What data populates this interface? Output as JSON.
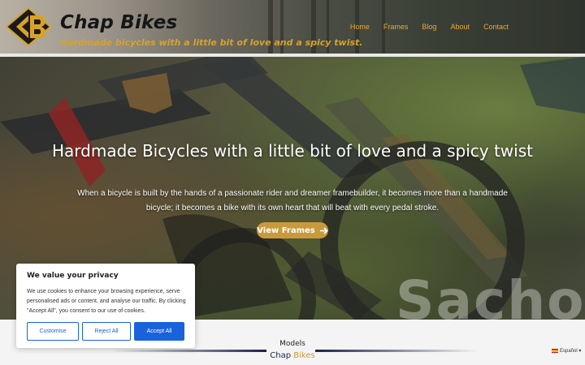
{
  "header": {
    "title": "Chap Bikes",
    "tagline": "Hardmade bicycles with a little bit of love and a spicy twist.",
    "nav": [
      "Home",
      "Frames",
      "Blog",
      "About",
      "Contact"
    ]
  },
  "hero": {
    "title": "Hardmade Bicycles with a little bit of love and a spicy twist",
    "text": "When a bicycle is built by the hands of a passionate rider and dreamer framebuilder, it becomes more than a handmade bicycle; it becomes a bike with its own heart that will beat with every pedal stroke.",
    "button_label": "View Frames",
    "watermark": "Sacho"
  },
  "models": {
    "label": "Models",
    "brand_word1": "Chap",
    "brand_word2": "Bikes"
  },
  "language": {
    "label": "Español ▾"
  },
  "cookie": {
    "title": "We value your privacy",
    "text": "We use cookies to enhance your browsing experience, serve personalised ads or content, and analyse our traffic. By clicking \"Accept All\", you consent to our use of cookies.",
    "customise": "Customise",
    "reject": "Reject All",
    "accept": "Accept All"
  },
  "colors": {
    "accent": "#c99a3b",
    "navy": "#1b2348",
    "cookie_blue": "#1863dc",
    "nav_text": "#e8a93a"
  },
  "icons": [
    "chap-logo-icon",
    "arrow-right-icon",
    "spain-flag-icon"
  ]
}
